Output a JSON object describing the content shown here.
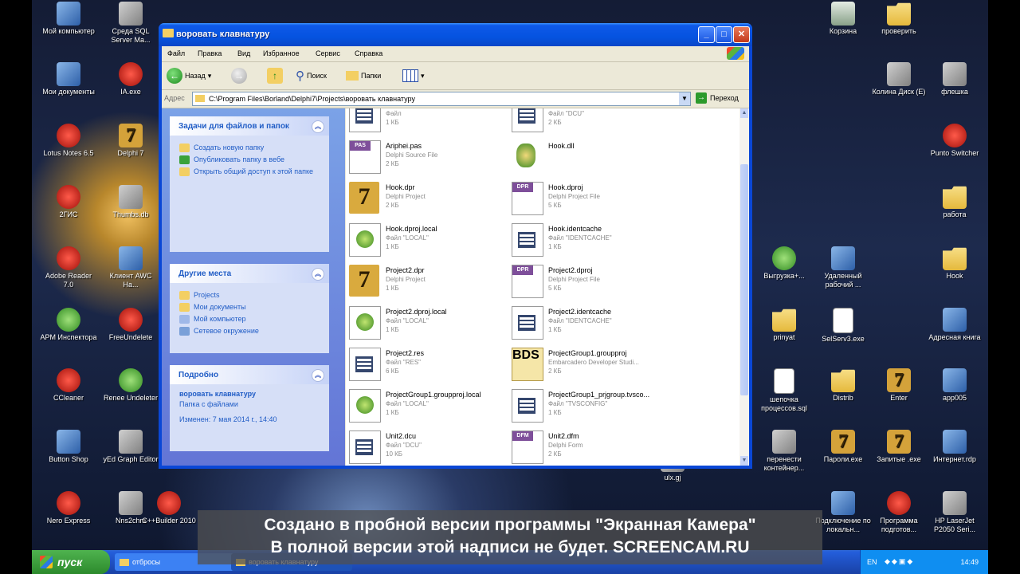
{
  "window": {
    "title": "воровать клавнатуру",
    "menu": [
      "Файл",
      "Правка",
      "Вид",
      "Избранное",
      "Сервис",
      "Справка"
    ],
    "toolbar": {
      "back": "Назад",
      "search": "Поиск",
      "folders": "Папки"
    },
    "address_label": "Адрес",
    "address_value": "C:\\Program Files\\Borland\\Delphi7\\Projects\\воровать клавнатуру",
    "go_label": "Переход"
  },
  "tasks": {
    "title": "Задачи для файлов и папок",
    "items": [
      "Создать новую папку",
      "Опубликовать папку в вебе",
      "Открыть общий доступ к этой папке"
    ]
  },
  "places": {
    "title": "Другие места",
    "items": [
      "Projects",
      "Мои документы",
      "Мой компьютер",
      "Сетевое окружение"
    ]
  },
  "details": {
    "title": "Подробно",
    "name": "воровать клавнатуру",
    "type": "Папка с файлами",
    "modified": "Изменен: 7 мая 2014 г., 14:40"
  },
  "files": [
    {
      "name": "",
      "type": "Файл",
      "size": "1 КБ",
      "icon": "doc"
    },
    {
      "name": "",
      "type": "Файл \"DCU\"",
      "size": "2 КБ",
      "icon": "doc"
    },
    {
      "name": "Ariphei.pas",
      "type": "Delphi Source File",
      "size": "2 КБ",
      "icon": "pas",
      "tag": "PAS"
    },
    {
      "name": "Hook.dll",
      "type": "",
      "size": "",
      "icon": "dll"
    },
    {
      "name": "Hook.dpr",
      "type": "Delphi Project",
      "size": "2 КБ",
      "icon": "seven"
    },
    {
      "name": "Hook.dproj",
      "type": "Delphi Project File",
      "size": "5 КБ",
      "icon": "tag",
      "tag": "DPR"
    },
    {
      "name": "Hook.dproj.local",
      "type": "Файл \"LOCAL\"",
      "size": "1 КБ",
      "icon": "proj"
    },
    {
      "name": "Hook.identcache",
      "type": "Файл \"IDENTCACHE\"",
      "size": "1 КБ",
      "icon": "doc"
    },
    {
      "name": "Project2.dpr",
      "type": "Delphi Project",
      "size": "1 КБ",
      "icon": "seven"
    },
    {
      "name": "Project2.dproj",
      "type": "Delphi Project File",
      "size": "5 КБ",
      "icon": "tag",
      "tag": "DPR"
    },
    {
      "name": "Project2.dproj.local",
      "type": "Файл \"LOCAL\"",
      "size": "1 КБ",
      "icon": "proj"
    },
    {
      "name": "Project2.identcache",
      "type": "Файл \"IDENTCACHE\"",
      "size": "1 КБ",
      "icon": "doc"
    },
    {
      "name": "Project2.res",
      "type": "Файл \"RES\"",
      "size": "6 КБ",
      "icon": "doc"
    },
    {
      "name": "ProjectGroup1.groupproj",
      "type": "Embarcadero Developer Studi...",
      "size": "2 КБ",
      "icon": "bds",
      "tag": "BDS"
    },
    {
      "name": "ProjectGroup1.groupproj.local",
      "type": "Файл \"LOCAL\"",
      "size": "1 КБ",
      "icon": "proj"
    },
    {
      "name": "ProjectGroup1_prjgroup.tvsco...",
      "type": "Файл \"TVSCONFIG\"",
      "size": "1 КБ",
      "icon": "doc"
    },
    {
      "name": "Unit2.dcu",
      "type": "Файл \"DCU\"",
      "size": "10 КБ",
      "icon": "doc"
    },
    {
      "name": "Unit2.dfm",
      "type": "Delphi Form",
      "size": "2 КБ",
      "icon": "tag",
      "tag": "DFM"
    }
  ],
  "desktop_icons": [
    {
      "label": "Мой компьютер",
      "g": "app"
    },
    {
      "label": "Среда SQL Server Ma...",
      "g": "gray"
    },
    {
      "label": "Мои документы",
      "g": "app"
    },
    {
      "label": "IA.exe",
      "g": "red"
    },
    {
      "label": "Lotus Notes 6.5",
      "g": "red"
    },
    {
      "label": "Delphi 7",
      "g": "seven"
    },
    {
      "label": "2ГИС",
      "g": "red"
    },
    {
      "label": "Thumbs.db",
      "g": "gray"
    },
    {
      "label": "Adobe Reader 7.0",
      "g": "red"
    },
    {
      "label": "Клиент AWC Ha...",
      "g": "app"
    },
    {
      "label": "APM Инспектора",
      "g": "green"
    },
    {
      "label": "FreeUndelete",
      "g": "red"
    },
    {
      "label": "CCleaner",
      "g": "red"
    },
    {
      "label": "Renee Undeleter",
      "g": "green"
    },
    {
      "label": "Button Shop",
      "g": "app"
    },
    {
      "label": "yEd Graph Editor",
      "g": "gray"
    },
    {
      "label": "Nero Express",
      "g": "red"
    },
    {
      "label": "Nns2chm",
      "g": "gray"
    },
    {
      "label": "C++Builder 2010",
      "g": "red"
    },
    {
      "label": "Корзина",
      "g": "bin"
    },
    {
      "label": "проверить",
      "g": "folder"
    },
    {
      "label": "Колина Диск (E)",
      "g": "gray"
    },
    {
      "label": "флешка",
      "g": "gray"
    },
    {
      "label": "Punto Switcher",
      "g": "red"
    },
    {
      "label": "работа",
      "g": "folder"
    },
    {
      "label": "Выгрузка+...",
      "g": "green"
    },
    {
      "label": "Удаленный рабочий ...",
      "g": "app"
    },
    {
      "label": "Hook",
      "g": "folder"
    },
    {
      "label": "prinyat",
      "g": "folder"
    },
    {
      "label": "SelServ3.exe",
      "g": "file"
    },
    {
      "label": "Адресная книга",
      "g": "app"
    },
    {
      "label": "шепочка процессов.sql",
      "g": "file"
    },
    {
      "label": "Distrib",
      "g": "folder"
    },
    {
      "label": "Enter",
      "g": "seven"
    },
    {
      "label": "app005",
      "g": "app"
    },
    {
      "label": "перенести контейнер...",
      "g": "gray"
    },
    {
      "label": "Пароли.exe",
      "g": "seven"
    },
    {
      "label": "Запитые .exe",
      "g": "seven"
    },
    {
      "label": "Интернет.rdp",
      "g": "app"
    },
    {
      "label": "Подключение по локальн...",
      "g": "app"
    },
    {
      "label": "Программа подготов...",
      "g": "red"
    },
    {
      "label": "HP LaserJet P2050 Seri...",
      "g": "gray"
    },
    {
      "label": "ulx.gj",
      "g": "gray"
    }
  ],
  "taskbar": {
    "start": "пуск",
    "tasks": [
      "отбросы",
      "воровать клавнатуру"
    ],
    "lang": "EN",
    "clock": "14:49"
  },
  "watermark": {
    "line1": "Создано в пробной версии программы \"Экранная Камера\"",
    "line2": "В полной версии этой надписи не будет. SCREENCAM.RU"
  }
}
